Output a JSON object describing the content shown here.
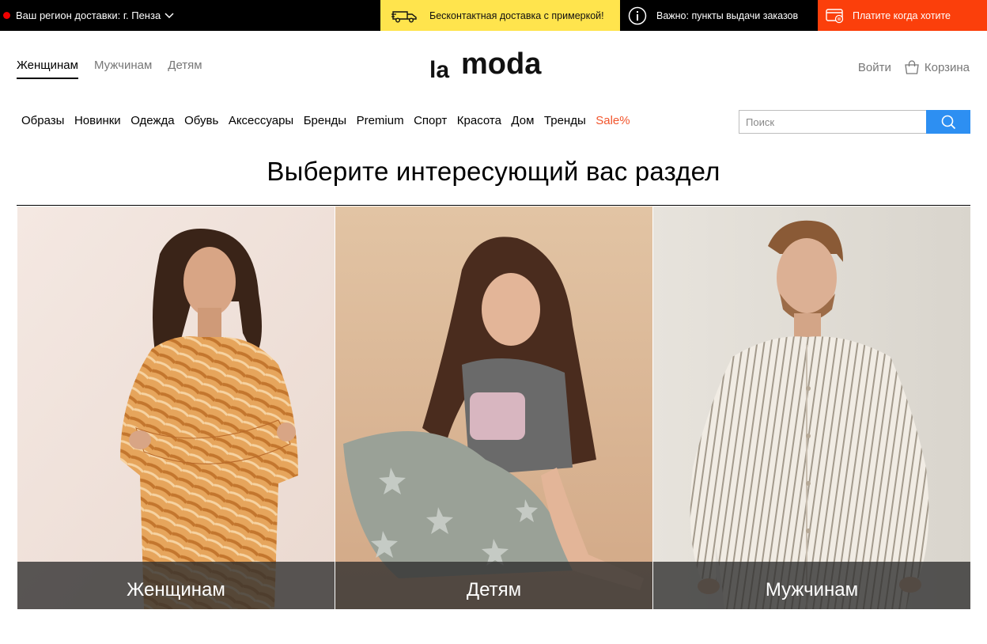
{
  "topbar": {
    "region_label": "Ваш регион доставки: г. Пенза",
    "promo_delivery": "Бесконтактная доставка с примеркой!",
    "promo_pickup": "Важно: пункты выдачи заказов",
    "promo_pay": "Платите когда хотите",
    "colors": {
      "yellow": "#ffe44d",
      "orange": "#fb3f0b",
      "dot": "#ee0000"
    }
  },
  "header": {
    "gender_tabs": [
      "Женщинам",
      "Мужчинам",
      "Детям"
    ],
    "active_tab": "Женщинам",
    "logo": "lamoda",
    "login": "Войти",
    "cart": "Корзина"
  },
  "menu": {
    "items": [
      "Образы",
      "Новинки",
      "Одежда",
      "Обувь",
      "Аксессуары",
      "Бренды",
      "Premium",
      "Спорт",
      "Красота",
      "Дом",
      "Тренды",
      "Sale%"
    ],
    "sale_color": "#f2552c"
  },
  "search": {
    "placeholder": "Поиск",
    "button_color": "#2d8ff2"
  },
  "page": {
    "heading": "Выберите интересующий вас раздел"
  },
  "tiles": [
    {
      "label": "Женщинам",
      "icon": "woman-photo"
    },
    {
      "label": "Детям",
      "icon": "child-photo"
    },
    {
      "label": "Мужчинам",
      "icon": "man-photo"
    }
  ]
}
